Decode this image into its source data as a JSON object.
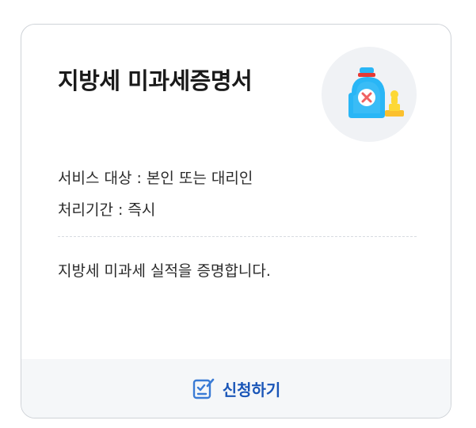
{
  "card": {
    "title": "지방세 미과세증명서",
    "illustration_icon": "tax-stamp-bag-icon",
    "service_target": "서비스 대상 : 본인 또는 대리인",
    "processing_period": "처리기간 : 즉시",
    "description": "지방세 미과세 실적을 증명합니다.",
    "apply_button_label": "신청하기",
    "apply_button_icon": "edit-checklist-icon"
  },
  "colors": {
    "accent": "#1a56b8",
    "bag_blue": "#29b6f6",
    "stamp_yellow": "#fdd835",
    "x_red": "#f06161",
    "footer_bg": "#f5f7f9"
  }
}
